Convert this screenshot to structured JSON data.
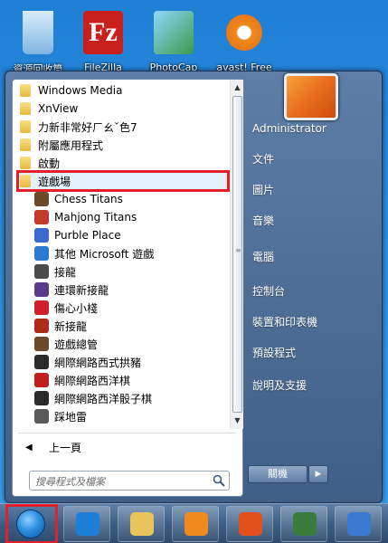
{
  "desktop": {
    "icons": [
      {
        "label": "資源回收筒",
        "icon": "recycle-bin-icon",
        "color": "#7fb6e0"
      },
      {
        "label": "FileZilla",
        "icon": "filezilla-icon",
        "color": "#c8201c"
      },
      {
        "label": "PhotoCap",
        "icon": "photocap-icon",
        "color": "#3a9a4a"
      },
      {
        "label": "avast! Free",
        "icon": "avast-icon",
        "color": "#f08a1c"
      }
    ]
  },
  "programs": {
    "folders": [
      {
        "label": "Windows Media",
        "icon": "folder-icon"
      },
      {
        "label": "XnView",
        "icon": "folder-icon"
      },
      {
        "label": "力新非常好ㄏㄠˇ色7",
        "icon": "folder-icon"
      },
      {
        "label": "附屬應用程式",
        "icon": "folder-icon"
      },
      {
        "label": "啟動",
        "icon": "folder-icon"
      },
      {
        "label": "遊戲場",
        "icon": "folder-icon",
        "selected": true
      }
    ],
    "games": [
      {
        "label": "Chess Titans",
        "icon": "chess-titans-icon",
        "color": "#6b4a2a"
      },
      {
        "label": "Mahjong Titans",
        "icon": "mahjong-titans-icon",
        "color": "#c23a2a"
      },
      {
        "label": "Purble Place",
        "icon": "purble-place-icon",
        "color": "#3a6ad0"
      },
      {
        "label": "其他 Microsoft 遊戲",
        "icon": "more-games-icon",
        "color": "#2a7ad0"
      },
      {
        "label": "接龍",
        "icon": "solitaire-icon",
        "color": "#4a4a4a"
      },
      {
        "label": "連環新接龍",
        "icon": "spider-solitaire-icon",
        "color": "#5a3a8a"
      },
      {
        "label": "傷心小棧",
        "icon": "hearts-icon",
        "color": "#d0202a"
      },
      {
        "label": "新接龍",
        "icon": "freecell-icon",
        "color": "#b02a1a"
      },
      {
        "label": "遊戲總管",
        "icon": "games-explorer-icon",
        "color": "#6a4a2a"
      },
      {
        "label": "網際網路西式拱豬",
        "icon": "internet-spades-icon",
        "color": "#2a2a2a"
      },
      {
        "label": "網際網路西洋棋",
        "icon": "internet-checkers-icon",
        "color": "#c0201a"
      },
      {
        "label": "網際網路西洋骰子棋",
        "icon": "internet-backgammon-icon",
        "color": "#2a2a2a"
      },
      {
        "label": "踩地雷",
        "icon": "minesweeper-icon",
        "color": "#5a5a5a"
      }
    ]
  },
  "back": {
    "label": "上一頁"
  },
  "search": {
    "placeholder": "搜尋程式及檔案"
  },
  "right_pane": {
    "items": [
      {
        "label": "Administrator",
        "name": "right-item-administrator"
      },
      {
        "label": "文件",
        "name": "right-item-documents"
      },
      {
        "label": "圖片",
        "name": "right-item-pictures"
      },
      {
        "label": "音樂",
        "name": "right-item-music"
      },
      {
        "label": "電腦",
        "name": "right-item-computer"
      },
      {
        "label": "控制台",
        "name": "right-item-control-panel"
      },
      {
        "label": "裝置和印表機",
        "name": "right-item-devices-printers"
      },
      {
        "label": "預設程式",
        "name": "right-item-default-programs"
      },
      {
        "label": "說明及支援",
        "name": "right-item-help-support"
      }
    ],
    "shutdown_label": "關機"
  },
  "taskbar": {
    "buttons": [
      {
        "icon": "internet-explorer-icon",
        "color": "#1e7fd8"
      },
      {
        "icon": "windows-explorer-icon",
        "color": "#e8c45a"
      },
      {
        "icon": "media-player-icon",
        "color": "#f08a1c"
      },
      {
        "icon": "firefox-icon",
        "color": "#e2501c"
      },
      {
        "icon": "media-center-icon",
        "color": "#3a7a3a"
      },
      {
        "icon": "control-panel-icon",
        "color": "#3a7ad0"
      }
    ]
  },
  "colors": {
    "highlight_outline": "#e2202a",
    "menu_frame": "#3f5f86"
  }
}
